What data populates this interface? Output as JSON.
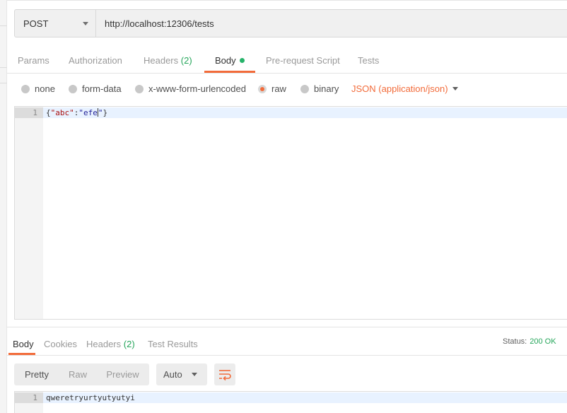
{
  "request": {
    "method": "POST",
    "url": "http://localhost:12306/tests"
  },
  "request_tabs": [
    {
      "label": "Params"
    },
    {
      "label": "Authorization"
    },
    {
      "label": "Headers",
      "count": "(2)"
    },
    {
      "label": "Body",
      "active": true
    },
    {
      "label": "Pre-request Script"
    },
    {
      "label": "Tests"
    }
  ],
  "body_types": [
    {
      "label": "none"
    },
    {
      "label": "form-data"
    },
    {
      "label": "x-www-form-urlencoded"
    },
    {
      "label": "raw",
      "selected": true
    },
    {
      "label": "binary"
    }
  ],
  "content_type": "JSON (application/json)",
  "request_editor": {
    "line_number": "1",
    "code_open": "{",
    "code_key": "\"abc\"",
    "code_colon": ":",
    "code_value": "\"efe",
    "code_value_end": "\"",
    "code_close": "}"
  },
  "response_tabs": [
    {
      "label": "Body",
      "active": true
    },
    {
      "label": "Cookies"
    },
    {
      "label": "Headers",
      "count": "(2)"
    },
    {
      "label": "Test Results"
    }
  ],
  "status": {
    "label": "Status:",
    "value": "200 OK"
  },
  "view_modes": [
    "Pretty",
    "Raw",
    "Preview"
  ],
  "format_select": "Auto",
  "response_editor": {
    "line_number": "1",
    "content": "qweretryurtyutyutyi"
  },
  "colors": {
    "accent": "#f26b3a",
    "success": "#26a65b"
  },
  "icons": {
    "method_caret": "chevron-down-icon",
    "content_type_caret": "chevron-down-icon",
    "wrap": "wrap-lines-icon"
  }
}
